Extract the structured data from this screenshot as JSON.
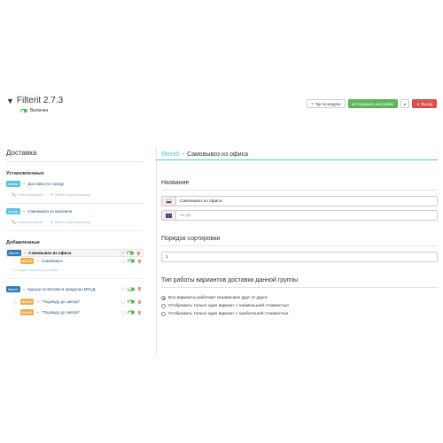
{
  "header": {
    "title": "Filterit 2.7.3",
    "status_label": "Включен",
    "tour_button": "Тур по модулю",
    "save_button": "Сохранить настройки",
    "exit_button": "Выход"
  },
  "left": {
    "heading": "Доставка",
    "installed_title": "Установленные",
    "installed": [
      {
        "code": "citylink",
        "name": "Доставка по городу",
        "search_label": "Поиск варианта",
        "remove_label": "Убрать код или маску"
      },
      {
        "code": "pickup",
        "name": "Самовывоз из магазина",
        "search_label": "Поиск варианта",
        "remove_label": "Убрать код или маску"
      }
    ],
    "added_title": "Добавленные",
    "added": [
      {
        "code": "filterit0",
        "name": "Самовывоз из офиса"
      },
      {
        "code": "filterit0",
        "name": "Самовывоз"
      },
      {
        "code": "filterit1",
        "name": "Курьер по Москве в пределах МКАД"
      },
      {
        "code": "filterit0",
        "name": "\"Подожду до завтра\""
      },
      {
        "code": "filterit1",
        "name": "\"Подожду до завтра\""
      }
    ],
    "add_variant_label": "Создать вариант доставки"
  },
  "right": {
    "code": "filterit0",
    "title": "Самовывоз из офиса",
    "name_label": "Название",
    "name_ru_value": "Самовывоз из офиса",
    "name_en_placeholder": "en-gb",
    "sort_label": "Порядок сортировки",
    "sort_value": "1",
    "mode_label": "Тип работы вариантов доставки данной группы",
    "options": [
      "Все варианты работают независимо друг от друга",
      "Отображать только один вариант с наименьшей стоимостью",
      "Отображать только один вариант с наибольшей стоимостью"
    ],
    "selected_option": 0
  },
  "colors": {
    "accent": "#5bc0de",
    "green": "#5cb85c",
    "red": "#d9534f",
    "orange": "#f0ad4e"
  }
}
